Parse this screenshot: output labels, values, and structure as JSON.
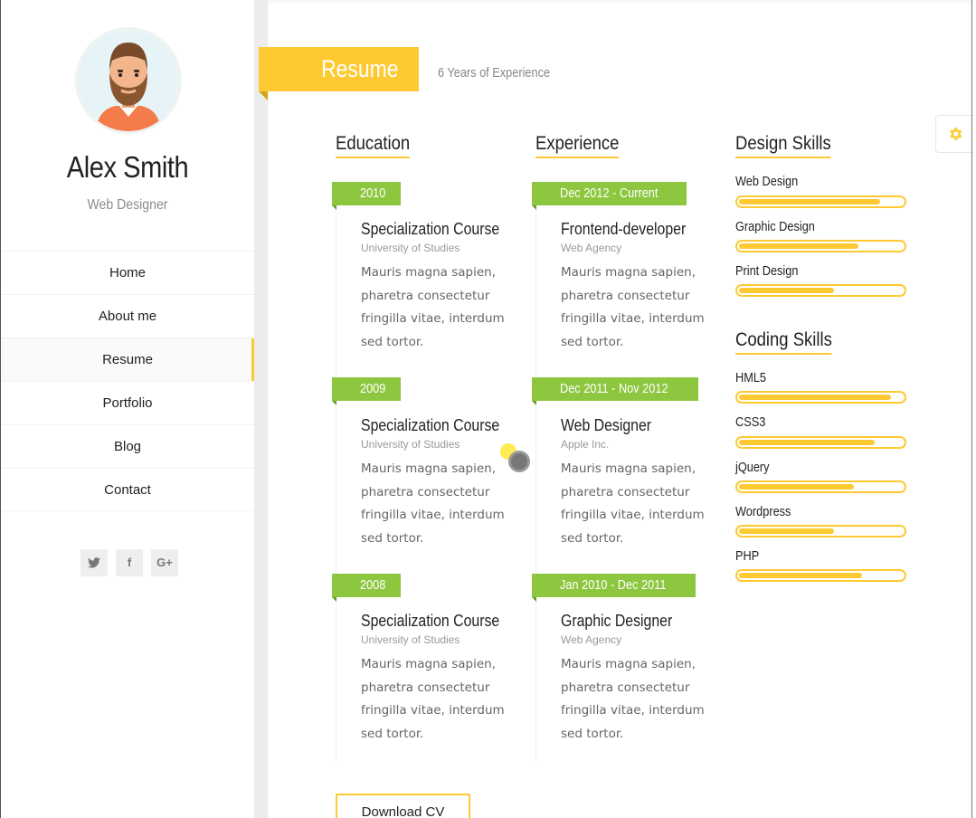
{
  "profile": {
    "name": "Alex Smith",
    "role": "Web Designer"
  },
  "nav": [
    {
      "label": "Home",
      "active": false
    },
    {
      "label": "About me",
      "active": false
    },
    {
      "label": "Resume",
      "active": true
    },
    {
      "label": "Portfolio",
      "active": false
    },
    {
      "label": "Blog",
      "active": false
    },
    {
      "label": "Contact",
      "active": false
    }
  ],
  "social": [
    {
      "icon": "twitter-icon",
      "glyph": "🐦"
    },
    {
      "icon": "facebook-icon",
      "glyph": "f"
    },
    {
      "icon": "google-plus-icon",
      "glyph": "G+"
    }
  ],
  "header": {
    "title": "Resume",
    "subtitle": "6 Years of Experience"
  },
  "settings": {
    "icon": "gear-icon"
  },
  "education": {
    "title": "Education",
    "entries": [
      {
        "date": "2010",
        "title": "Specialization Course",
        "org": "University of Studies",
        "text": "Mauris magna sapien, pharetra consectetur fringilla vitae, interdum sed tortor."
      },
      {
        "date": "2009",
        "title": "Specialization Course",
        "org": "University of Studies",
        "text": "Mauris magna sapien, pharetra consectetur fringilla vitae, interdum sed tortor."
      },
      {
        "date": "2008",
        "title": "Specialization Course",
        "org": "University of Studies",
        "text": "Mauris magna sapien, pharetra consectetur fringilla vitae, interdum sed tortor."
      }
    ]
  },
  "experience": {
    "title": "Experience",
    "entries": [
      {
        "date": "Dec 2012 - Current",
        "title": "Frontend-developer",
        "org": "Web Agency",
        "text": "Mauris magna sapien, pharetra consectetur fringilla vitae, interdum sed tortor."
      },
      {
        "date": "Dec 2011 - Nov 2012",
        "title": "Web Designer",
        "org": "Apple Inc.",
        "text": "Mauris magna sapien, pharetra consectetur fringilla vitae, interdum sed tortor."
      },
      {
        "date": "Jan 2010 - Dec 2011",
        "title": "Graphic Designer",
        "org": "Web Agency",
        "text": "Mauris magna sapien, pharetra consectetur fringilla vitae, interdum sed tortor."
      }
    ]
  },
  "design_skills": {
    "title": "Design Skills",
    "items": [
      {
        "label": "Web Design",
        "level": 0.86
      },
      {
        "label": "Graphic Design",
        "level": 0.73
      },
      {
        "label": "Print Design",
        "level": 0.58
      }
    ]
  },
  "coding_skills": {
    "title": "Coding Skills",
    "items": [
      {
        "label": "HML5",
        "level": 0.93
      },
      {
        "label": "CSS3",
        "level": 0.83
      },
      {
        "label": "jQuery",
        "level": 0.7
      },
      {
        "label": "Wordpress",
        "level": 0.58
      },
      {
        "label": "PHP",
        "level": 0.75
      }
    ]
  },
  "download": {
    "label": "Download CV"
  },
  "colors": {
    "accent": "#fec931",
    "green": "#8dc63f"
  }
}
